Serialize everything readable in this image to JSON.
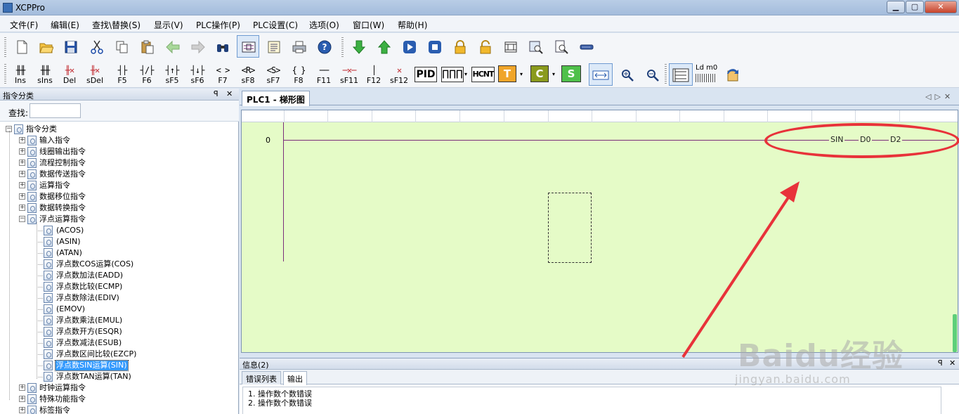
{
  "window": {
    "title": "XCPPro",
    "minimize": "▁",
    "maximize": "▢",
    "close": "✕"
  },
  "menu": [
    "文件(F)",
    "编辑(E)",
    "查找\\替换(S)",
    "显示(V)",
    "PLC操作(P)",
    "PLC设置(C)",
    "选项(O)",
    "窗口(W)",
    "帮助(H)"
  ],
  "toolbar1": {
    "icons": [
      "new-file-icon",
      "open-folder-icon",
      "save-icon",
      "cut-icon",
      "copy-icon",
      "paste-icon",
      "undo-arrow-icon",
      "redo-arrow-icon",
      "find-binoculars-icon",
      "ladder-view-icon",
      "instruction-list-icon",
      "print-icon",
      "help-icon",
      "download-arrow-icon",
      "upload-arrow-icon",
      "run-icon",
      "stop-icon",
      "lock-icon",
      "unlock-icon",
      "film-icon",
      "monitor-search-icon",
      "document-search-icon",
      "serial-port-icon"
    ]
  },
  "toolbar2": {
    "items": [
      {
        "glyph": "╫╫",
        "label": "Ins"
      },
      {
        "glyph": "╫╫",
        "label": "sIns"
      },
      {
        "glyph": "╫✕",
        "label": "Del"
      },
      {
        "glyph": "╫✕",
        "label": "sDel"
      },
      {
        "glyph": "┤├",
        "label": "F5"
      },
      {
        "glyph": "┤/├",
        "label": "F6"
      },
      {
        "glyph": "┤↑├",
        "label": "sF5"
      },
      {
        "glyph": "┤↓├",
        "label": "sF6"
      },
      {
        "glyph": "< >",
        "label": "F7"
      },
      {
        "glyph": "<R>",
        "label": "sF8"
      },
      {
        "glyph": "<S>",
        "label": "sF7"
      },
      {
        "glyph": "{ }",
        "label": "F8"
      },
      {
        "glyph": "──",
        "label": "F11"
      },
      {
        "glyph": "─✕─",
        "label": "sF11"
      },
      {
        "glyph": "│",
        "label": "F12"
      },
      {
        "glyph": "✕",
        "label": "sF12"
      }
    ],
    "pid": "PID",
    "pulse": "∏∏∏",
    "hcnt": "HCNT",
    "t": "T",
    "c": "C",
    "s": "S",
    "ld": "Ld m0"
  },
  "left_panel": {
    "title": "指令分类",
    "pin": "ꟼ",
    "close": "✕",
    "search_label": "查找:",
    "search_value": "",
    "tree": [
      {
        "text": "指令分类",
        "level": 0,
        "exp": "−"
      },
      {
        "text": "输入指令",
        "level": 1,
        "exp": "+"
      },
      {
        "text": "线圈输出指令",
        "level": 1,
        "exp": "+"
      },
      {
        "text": "流程控制指令",
        "level": 1,
        "exp": "+"
      },
      {
        "text": "数据传送指令",
        "level": 1,
        "exp": "+"
      },
      {
        "text": "运算指令",
        "level": 1,
        "exp": "+"
      },
      {
        "text": "数据移位指令",
        "level": 1,
        "exp": "+"
      },
      {
        "text": "数据转换指令",
        "level": 1,
        "exp": "+"
      },
      {
        "text": "浮点运算指令",
        "level": 1,
        "exp": "−"
      },
      {
        "text": "(ACOS)",
        "level": 2
      },
      {
        "text": "(ASIN)",
        "level": 2
      },
      {
        "text": "(ATAN)",
        "level": 2
      },
      {
        "text": "浮点数COS运算(COS)",
        "level": 2
      },
      {
        "text": "浮点数加法(EADD)",
        "level": 2
      },
      {
        "text": "浮点数比较(ECMP)",
        "level": 2
      },
      {
        "text": "浮点数除法(EDIV)",
        "level": 2
      },
      {
        "text": "(EMOV)",
        "level": 2
      },
      {
        "text": "浮点数乘法(EMUL)",
        "level": 2
      },
      {
        "text": "浮点数开方(ESQR)",
        "level": 2
      },
      {
        "text": "浮点数减法(ESUB)",
        "level": 2
      },
      {
        "text": "浮点数区间比较(EZCP)",
        "level": 2
      },
      {
        "text": "浮点数SIN运算(SIN)",
        "level": 2,
        "selected": true
      },
      {
        "text": "浮点数TAN运算(TAN)",
        "level": 2
      },
      {
        "text": "时钟运算指令",
        "level": 1,
        "exp": "+"
      },
      {
        "text": "特殊功能指令",
        "level": 1,
        "exp": "+"
      },
      {
        "text": "标签指令",
        "level": 1,
        "exp": "+"
      }
    ]
  },
  "editor": {
    "tab_label": "PLC1 - 梯形图",
    "tab_nav": "◁▷✕",
    "row_number": "0",
    "instruction": {
      "op": "SIN",
      "src": "D0",
      "dst": "D2"
    }
  },
  "info_panel": {
    "title": "信息(2)",
    "pin": "ꟼ",
    "close": "✕",
    "tabs": [
      "错误列表",
      "输出"
    ],
    "messages": [
      "1. 操作数个数错误",
      "2. 操作数个数错误"
    ]
  },
  "watermark": {
    "brand": "Baidu经验",
    "url": "jingyan.baidu.com"
  },
  "colors": {
    "ladder_bg": "#e5fbc7",
    "rung": "#7a2d7a",
    "annotation_red": "#e8323a",
    "selection": "#3399ff"
  }
}
